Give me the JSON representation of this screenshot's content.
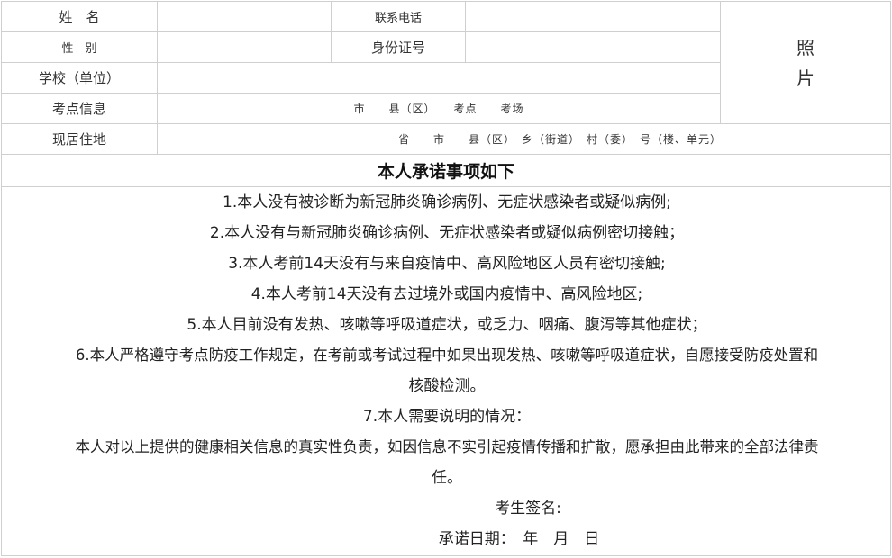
{
  "form": {
    "name_label": "姓　名",
    "phone_label": "联系电话",
    "gender_label": "性　别",
    "id_label": "身份证号",
    "school_label": "学校（单位）",
    "exam_label": "考点信息",
    "exam_value": "市　　县（区）　　考点　　考场",
    "address_label": "现居住地",
    "address_value": "省　　市　　县（区）　乡（街道）　村（委）　号（楼、单元）",
    "photo_line1": "照",
    "photo_line2": "片"
  },
  "commitment": {
    "title": "本人承诺事项如下",
    "items": [
      "1.本人没有被诊断为新冠肺炎确诊病例、无症状感染者或疑似病例;",
      "2.本人没有与新冠肺炎确诊病例、无症状感染者或疑似病例密切接触；",
      "3.本人考前14天没有与来自疫情中、高风险地区人员有密切接触;",
      "4.本人考前14天没有去过境外或国内疫情中、高风险地区;",
      "5.本人目前没有发热、咳嗽等呼吸道症状，或乏力、咽痛、腹泻等其他症状；",
      "6.本人严格遵守考点防疫工作规定，在考前或考试过程中如果出现发热、咳嗽等呼吸道症状，自愿接受防疫处置和",
      "核酸检测。",
      "7.本人需要说明的情况："
    ],
    "statement_line1": "本人对以上提供的健康相关信息的真实性负责，如因信息不实引起疫情传播和扩散，愿承担由此带来的全部法律责",
    "statement_line2": "任。",
    "signature_label": "考生签名:",
    "date_label": "承诺日期：　年　月　日"
  }
}
